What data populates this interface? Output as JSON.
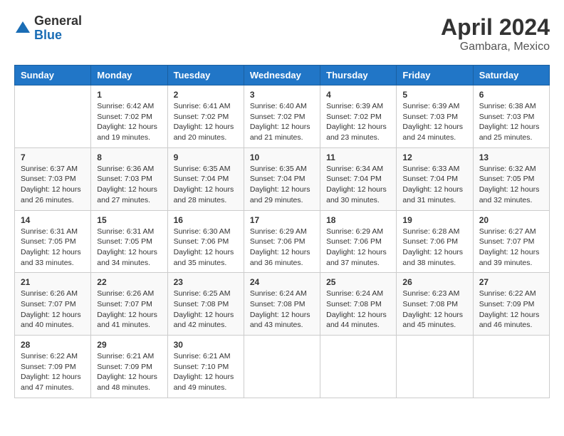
{
  "logo": {
    "general": "General",
    "blue": "Blue"
  },
  "title": "April 2024",
  "location": "Gambara, Mexico",
  "days_header": [
    "Sunday",
    "Monday",
    "Tuesday",
    "Wednesday",
    "Thursday",
    "Friday",
    "Saturday"
  ],
  "weeks": [
    [
      {
        "day": "",
        "sunrise": "",
        "sunset": "",
        "daylight": ""
      },
      {
        "day": "1",
        "sunrise": "Sunrise: 6:42 AM",
        "sunset": "Sunset: 7:02 PM",
        "daylight": "Daylight: 12 hours and 19 minutes."
      },
      {
        "day": "2",
        "sunrise": "Sunrise: 6:41 AM",
        "sunset": "Sunset: 7:02 PM",
        "daylight": "Daylight: 12 hours and 20 minutes."
      },
      {
        "day": "3",
        "sunrise": "Sunrise: 6:40 AM",
        "sunset": "Sunset: 7:02 PM",
        "daylight": "Daylight: 12 hours and 21 minutes."
      },
      {
        "day": "4",
        "sunrise": "Sunrise: 6:39 AM",
        "sunset": "Sunset: 7:02 PM",
        "daylight": "Daylight: 12 hours and 23 minutes."
      },
      {
        "day": "5",
        "sunrise": "Sunrise: 6:39 AM",
        "sunset": "Sunset: 7:03 PM",
        "daylight": "Daylight: 12 hours and 24 minutes."
      },
      {
        "day": "6",
        "sunrise": "Sunrise: 6:38 AM",
        "sunset": "Sunset: 7:03 PM",
        "daylight": "Daylight: 12 hours and 25 minutes."
      }
    ],
    [
      {
        "day": "7",
        "sunrise": "Sunrise: 6:37 AM",
        "sunset": "Sunset: 7:03 PM",
        "daylight": "Daylight: 12 hours and 26 minutes."
      },
      {
        "day": "8",
        "sunrise": "Sunrise: 6:36 AM",
        "sunset": "Sunset: 7:03 PM",
        "daylight": "Daylight: 12 hours and 27 minutes."
      },
      {
        "day": "9",
        "sunrise": "Sunrise: 6:35 AM",
        "sunset": "Sunset: 7:04 PM",
        "daylight": "Daylight: 12 hours and 28 minutes."
      },
      {
        "day": "10",
        "sunrise": "Sunrise: 6:35 AM",
        "sunset": "Sunset: 7:04 PM",
        "daylight": "Daylight: 12 hours and 29 minutes."
      },
      {
        "day": "11",
        "sunrise": "Sunrise: 6:34 AM",
        "sunset": "Sunset: 7:04 PM",
        "daylight": "Daylight: 12 hours and 30 minutes."
      },
      {
        "day": "12",
        "sunrise": "Sunrise: 6:33 AM",
        "sunset": "Sunset: 7:04 PM",
        "daylight": "Daylight: 12 hours and 31 minutes."
      },
      {
        "day": "13",
        "sunrise": "Sunrise: 6:32 AM",
        "sunset": "Sunset: 7:05 PM",
        "daylight": "Daylight: 12 hours and 32 minutes."
      }
    ],
    [
      {
        "day": "14",
        "sunrise": "Sunrise: 6:31 AM",
        "sunset": "Sunset: 7:05 PM",
        "daylight": "Daylight: 12 hours and 33 minutes."
      },
      {
        "day": "15",
        "sunrise": "Sunrise: 6:31 AM",
        "sunset": "Sunset: 7:05 PM",
        "daylight": "Daylight: 12 hours and 34 minutes."
      },
      {
        "day": "16",
        "sunrise": "Sunrise: 6:30 AM",
        "sunset": "Sunset: 7:06 PM",
        "daylight": "Daylight: 12 hours and 35 minutes."
      },
      {
        "day": "17",
        "sunrise": "Sunrise: 6:29 AM",
        "sunset": "Sunset: 7:06 PM",
        "daylight": "Daylight: 12 hours and 36 minutes."
      },
      {
        "day": "18",
        "sunrise": "Sunrise: 6:29 AM",
        "sunset": "Sunset: 7:06 PM",
        "daylight": "Daylight: 12 hours and 37 minutes."
      },
      {
        "day": "19",
        "sunrise": "Sunrise: 6:28 AM",
        "sunset": "Sunset: 7:06 PM",
        "daylight": "Daylight: 12 hours and 38 minutes."
      },
      {
        "day": "20",
        "sunrise": "Sunrise: 6:27 AM",
        "sunset": "Sunset: 7:07 PM",
        "daylight": "Daylight: 12 hours and 39 minutes."
      }
    ],
    [
      {
        "day": "21",
        "sunrise": "Sunrise: 6:26 AM",
        "sunset": "Sunset: 7:07 PM",
        "daylight": "Daylight: 12 hours and 40 minutes."
      },
      {
        "day": "22",
        "sunrise": "Sunrise: 6:26 AM",
        "sunset": "Sunset: 7:07 PM",
        "daylight": "Daylight: 12 hours and 41 minutes."
      },
      {
        "day": "23",
        "sunrise": "Sunrise: 6:25 AM",
        "sunset": "Sunset: 7:08 PM",
        "daylight": "Daylight: 12 hours and 42 minutes."
      },
      {
        "day": "24",
        "sunrise": "Sunrise: 6:24 AM",
        "sunset": "Sunset: 7:08 PM",
        "daylight": "Daylight: 12 hours and 43 minutes."
      },
      {
        "day": "25",
        "sunrise": "Sunrise: 6:24 AM",
        "sunset": "Sunset: 7:08 PM",
        "daylight": "Daylight: 12 hours and 44 minutes."
      },
      {
        "day": "26",
        "sunrise": "Sunrise: 6:23 AM",
        "sunset": "Sunset: 7:08 PM",
        "daylight": "Daylight: 12 hours and 45 minutes."
      },
      {
        "day": "27",
        "sunrise": "Sunrise: 6:22 AM",
        "sunset": "Sunset: 7:09 PM",
        "daylight": "Daylight: 12 hours and 46 minutes."
      }
    ],
    [
      {
        "day": "28",
        "sunrise": "Sunrise: 6:22 AM",
        "sunset": "Sunset: 7:09 PM",
        "daylight": "Daylight: 12 hours and 47 minutes."
      },
      {
        "day": "29",
        "sunrise": "Sunrise: 6:21 AM",
        "sunset": "Sunset: 7:09 PM",
        "daylight": "Daylight: 12 hours and 48 minutes."
      },
      {
        "day": "30",
        "sunrise": "Sunrise: 6:21 AM",
        "sunset": "Sunset: 7:10 PM",
        "daylight": "Daylight: 12 hours and 49 minutes."
      },
      {
        "day": "",
        "sunrise": "",
        "sunset": "",
        "daylight": ""
      },
      {
        "day": "",
        "sunrise": "",
        "sunset": "",
        "daylight": ""
      },
      {
        "day": "",
        "sunrise": "",
        "sunset": "",
        "daylight": ""
      },
      {
        "day": "",
        "sunrise": "",
        "sunset": "",
        "daylight": ""
      }
    ]
  ]
}
